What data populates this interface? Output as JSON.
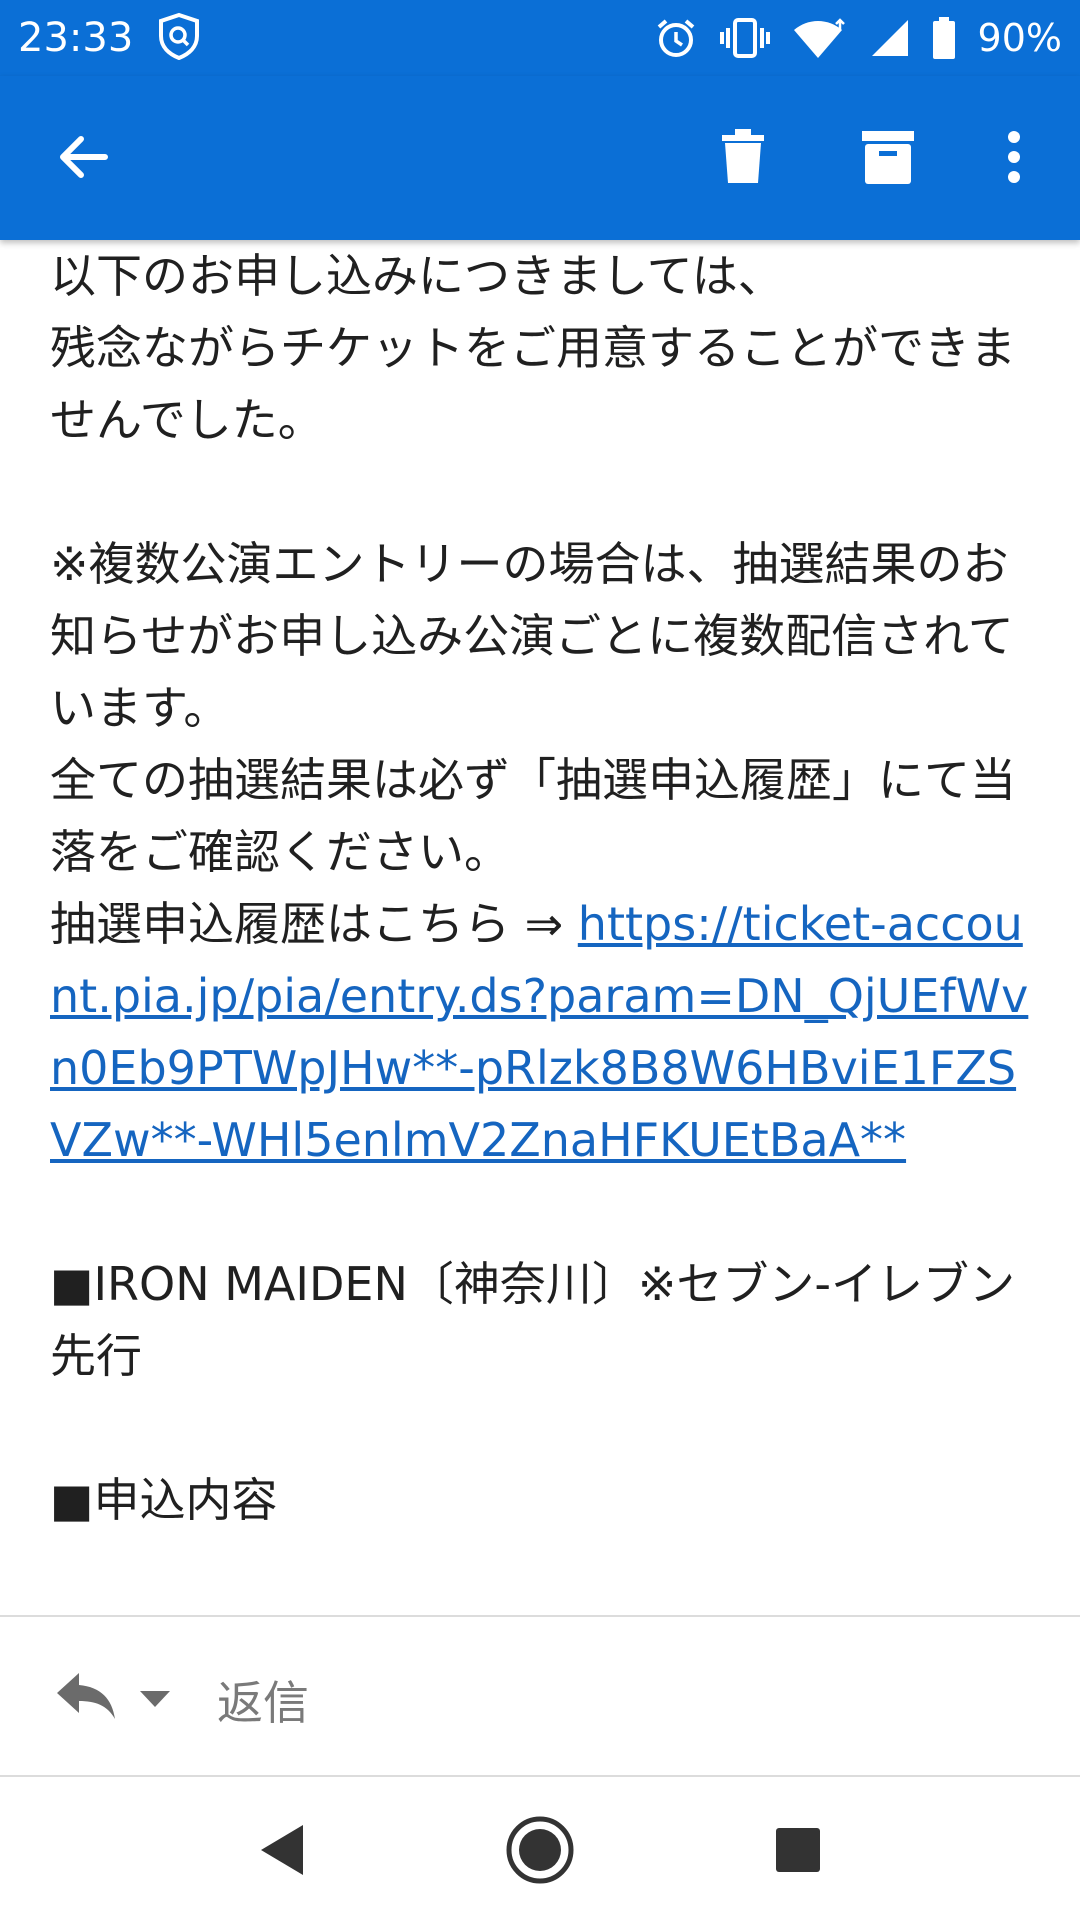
{
  "status_bar": {
    "time": "23:33",
    "battery": "90%",
    "icons": [
      "shield-icon",
      "alarm-icon",
      "vibrate-icon",
      "wifi-icon",
      "signal-icon",
      "battery-icon"
    ]
  },
  "app_bar": {
    "icons": [
      "back-arrow-icon",
      "trash-icon",
      "archive-icon",
      "more-vert-icon"
    ]
  },
  "email": {
    "p1": "以下のお申し込みにつきましては、\n残念ながらチケットをご用意することができませんでした。",
    "p2": "※複数公演エントリーの場合は、抽選結果のお知らせがお申し込み公演ごとに複数配信されています。\n全ての抽選結果は必ず「抽選申込履歴」にて当落をご確認ください。\n抽選申込履歴はこちら ⇒ ",
    "link": "https://ticket-account.pia.jp/pia/entry.ds?param=DN_QjUEfWvn0Eb9PTWpJHw**-pRlzk8B8W6HBviE1FZSVZw**-WHl5enlmV2ZnaHFKUEtBaA**",
    "p3": "■IRON MAIDEN〔神奈川〕※セブン-イレブン先行",
    "p4": "■申込内容"
  },
  "reply_bar": {
    "label": "返信"
  },
  "nav_bar": {
    "icons": [
      "back-triangle-icon",
      "home-circle-icon",
      "recents-square-icon"
    ]
  },
  "colors": {
    "accent": "#0b6fd6",
    "link": "#1565c0"
  }
}
